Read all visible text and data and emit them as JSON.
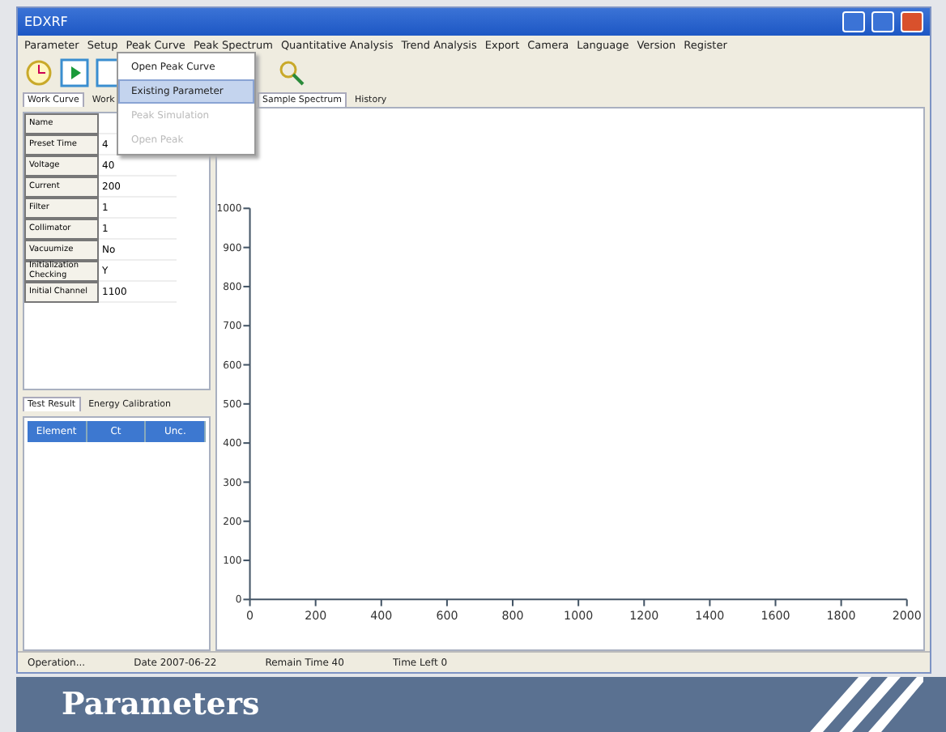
{
  "window": {
    "title": "EDXRF"
  },
  "menu": [
    "Parameter",
    "Setup",
    "Peak Curve",
    "Peak Spectrum",
    "Quantitative Analysis",
    "Trend Analysis",
    "Export",
    "Camera",
    "Language",
    "Version",
    "Register"
  ],
  "dropdown": [
    {
      "label": "Open Peak Curve",
      "selected": false,
      "disabled": false
    },
    {
      "label": "Existing Parameter",
      "selected": true,
      "disabled": false
    },
    {
      "label": "Peak Simulation",
      "selected": false,
      "disabled": true
    },
    {
      "label": "Open Peak",
      "selected": false,
      "disabled": true
    }
  ],
  "left_tabs": [
    {
      "label": "Work Curve",
      "selected": true
    },
    {
      "label": "Work",
      "selected": false
    }
  ],
  "parameters": [
    {
      "name": "Name"
    },
    {
      "name": "Preset Time",
      "value": "4"
    },
    {
      "name": "Voltage",
      "value": "40"
    },
    {
      "name": "Current",
      "value": "200"
    },
    {
      "name": "Filter",
      "value": "1"
    },
    {
      "name": "Collimator",
      "value": "1"
    },
    {
      "name": "Vacuumize",
      "value": "No"
    },
    {
      "name": "Initialization Checking",
      "value": "Y"
    },
    {
      "name": "Initial Channel",
      "value": "1100"
    }
  ],
  "result_tabs": [
    {
      "label": "Test Result",
      "selected": true
    },
    {
      "label": "Energy Calibration",
      "selected": false
    }
  ],
  "result_columns": [
    "Element",
    "Ct",
    "Unc."
  ],
  "chart_tabs": [
    {
      "label": "Sample Spectrum",
      "selected": true
    },
    {
      "label": "History",
      "selected": false
    }
  ],
  "chart": {
    "chart_data": {
      "type": "line",
      "xlim": [
        0,
        2000
      ],
      "ylim": [
        0,
        1000
      ],
      "xticks": [
        0,
        200,
        400,
        600,
        800,
        1000,
        1200,
        1400,
        1600,
        1800,
        2000
      ],
      "yticks": [
        0,
        100,
        200,
        300,
        400,
        500,
        600,
        700,
        800,
        900,
        1000
      ]
    }
  },
  "status_bar": [
    "Operation...",
    "Date 2007-06-22",
    "Remain Time 40",
    "Time Left 0"
  ],
  "banner": {
    "title": "Parameters"
  }
}
